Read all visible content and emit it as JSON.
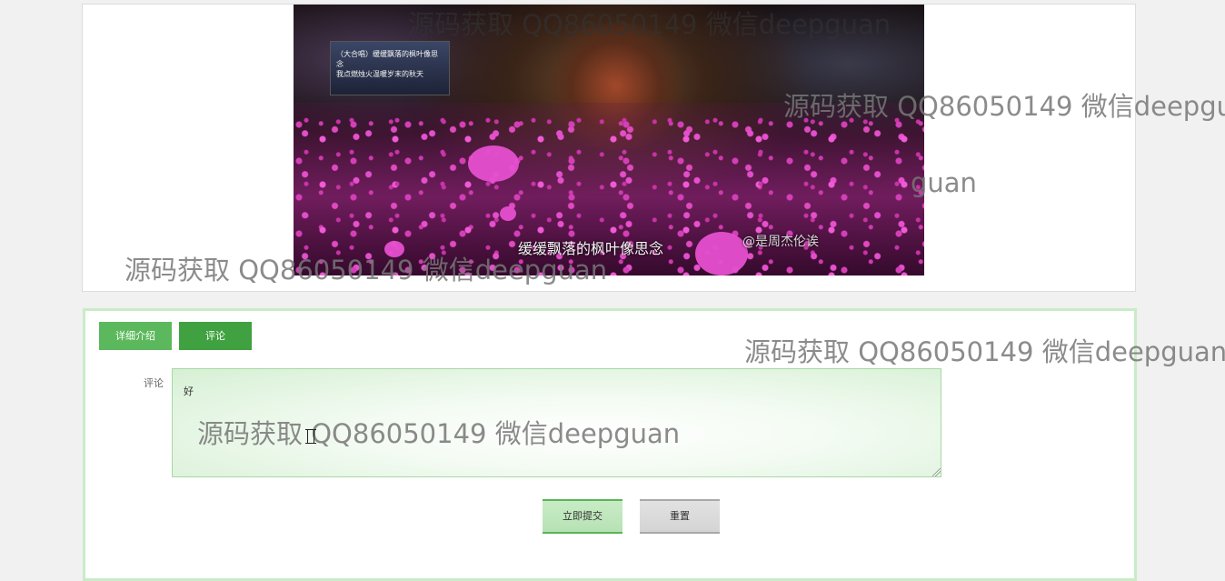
{
  "video": {
    "subtitle": "缓缓飘落的枫叶像思念",
    "handle": "@是周杰伦诶",
    "screen_text": "（大合唱）缓缓飘落的枫叶像思念\n我点燃烛火温暖岁末的秋天"
  },
  "watermarks": [
    "源码获取 QQ86050149 微信deepguan",
    "源码获取 QQ86050149 微信deepgu",
    "guan",
    "源码获取 QQ86050149 微信deepguan",
    "源码获取 QQ86050149 微信deepguan",
    "源码获取 QQ86050149 微信deepguan"
  ],
  "tabs": {
    "detail_label": "详细介绍",
    "comment_label": "评论"
  },
  "comment_form": {
    "field_label": "评论",
    "value": "好"
  },
  "buttons": {
    "submit_label": "立即提交",
    "reset_label": "重置"
  },
  "colors": {
    "tab_detail": "#5cb85c",
    "tab_comment": "#3fa13f",
    "card_border": "#c9ecc7"
  }
}
